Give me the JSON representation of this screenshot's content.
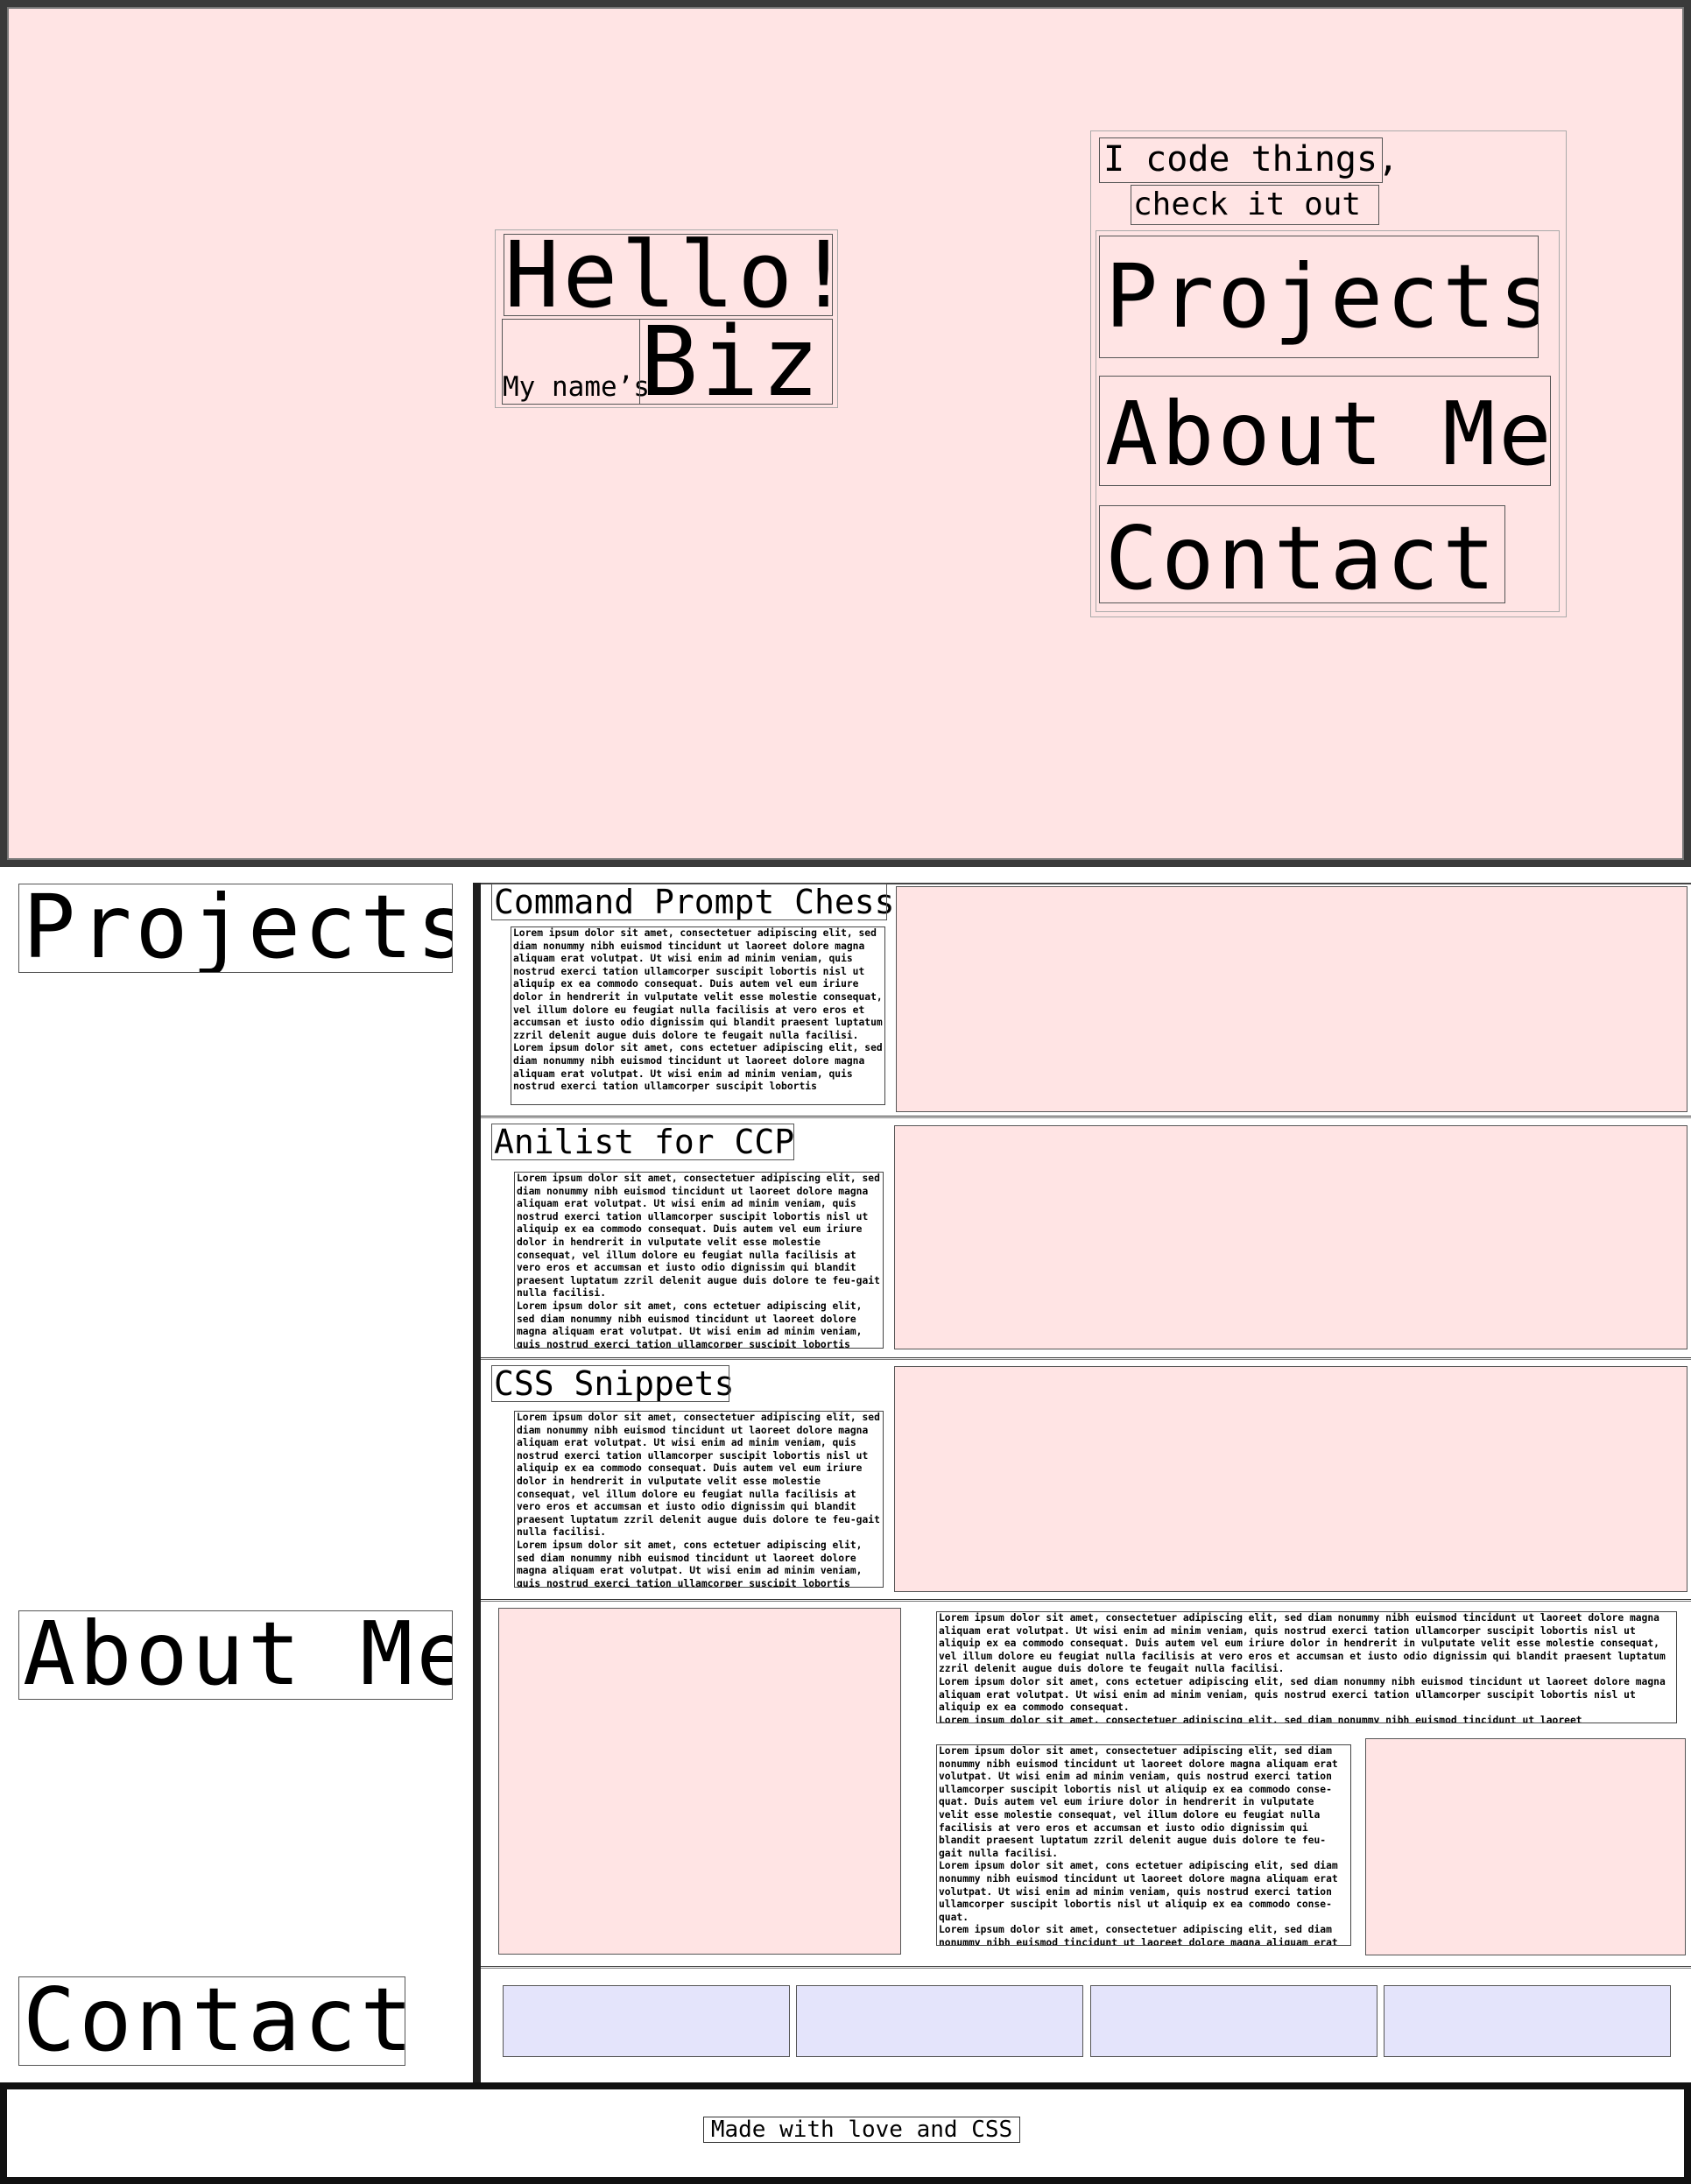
{
  "hero": {
    "hello": "Hello!",
    "my_name": "My name’s",
    "name": "Biz",
    "tagline_line1": "I code things,",
    "tagline_line2": "check it out",
    "nav": [
      "Projects",
      "About Me",
      "Contact"
    ]
  },
  "sections": {
    "projects_heading": "Projects",
    "about_heading": "About Me",
    "contact_heading": "Contact"
  },
  "projects": [
    {
      "title": "Command Prompt Chess",
      "text": "Lorem ipsum dolor sit amet, consectetuer adipiscing elit, sed diam nonummy nibh euismod tincidunt ut laoreet dolore magna aliquam erat volutpat. Ut wisi enim ad minim veniam, quis nostrud exerci tation ullamcorper suscipit lobortis nisl ut aliquip ex ea commodo consequat. Duis autem vel eum iriure dolor in hendrerit in vulputate velit esse molestie consequat, vel illum dolore eu feugiat nulla facilisis at vero eros et accumsan et iusto odio dignissim qui blandit praesent luptatum zzril delenit augue duis dolore te feugait nulla facilisi.\nLorem ipsum dolor sit amet, cons ectetuer adipiscing elit, sed diam nonummy nibh euismod tincidunt ut laoreet dolore magna aliquam erat volutpat. Ut wisi enim ad minim veniam, quis nostrud exerci tation ullamcorper suscipit lobortis"
    },
    {
      "title": "Anilist for CCP",
      "text": "Lorem ipsum dolor sit amet, consectetuer adipiscing elit, sed diam nonummy nibh euismod tincidunt ut laoreet dolore magna aliquam erat volutpat. Ut wisi enim ad minim veniam, quis nostrud exerci tation ullamcorper suscipit lobortis nisl ut aliquip ex ea commodo consequat. Duis autem vel eum iriure dolor in hendrerit in vulputate velit esse molestie consequat, vel illum dolore eu feugiat nulla facilisis at vero eros et accumsan et iusto odio dignissim qui blandit praesent luptatum zzril delenit augue duis dolore te feu-gait nulla facilisi.\nLorem ipsum dolor sit amet, cons ectetuer adipiscing elit, sed diam nonummy nibh euismod tincidunt ut laoreet dolore magna aliquam erat volutpat. Ut wisi enim ad minim veniam, quis nostrud exerci tation ullamcorper suscipit lobortis"
    },
    {
      "title": "CSS Snippets",
      "text": "Lorem ipsum dolor sit amet, consectetuer adipiscing elit, sed diam nonummy nibh euismod tincidunt ut laoreet dolore magna aliquam erat volutpat. Ut wisi enim ad minim veniam, quis nostrud exerci tation ullamcorper suscipit lobortis nisl ut aliquip ex ea commodo consequat. Duis autem vel eum iriure dolor in hendrerit in vulputate velit esse molestie consequat, vel illum dolore eu feugiat nulla facilisis at vero eros et accumsan et iusto odio dignissim qui blandit praesent luptatum zzril delenit augue duis dolore te feu-gait nulla facilisi.\nLorem ipsum dolor sit amet, cons ectetuer adipiscing elit, sed diam nonummy nibh euismod tincidunt ut laoreet dolore magna aliquam erat volutpat. Ut wisi enim ad minim veniam, quis nostrud exerci tation ullamcorper suscipit lobortis"
    }
  ],
  "about": {
    "text_top": "Lorem ipsum dolor sit amet, consectetuer adipiscing elit, sed diam nonummy nibh euismod tincidunt ut laoreet dolore magna aliquam erat volutpat. Ut wisi enim ad minim veniam, quis nostrud exerci tation ullamcorper suscipit lobortis nisl ut aliquip ex ea commodo consequat. Duis autem vel eum iriure dolor in hendrerit in vulputate velit esse molestie consequat, vel illum dolore eu feugiat nulla facilisis at vero eros et accumsan et iusto odio dignissim qui blandit praesent luptatum zzril delenit augue duis dolore te feugait nulla facilisi.\nLorem ipsum dolor sit amet, cons ectetuer adipiscing elit, sed diam nonummy nibh euismod tincidunt ut laoreet dolore magna aliquam erat volutpat. Ut wisi enim ad minim veniam, quis nostrud exerci tation ullamcorper suscipit lobortis nisl ut aliquip ex ea commodo consequat.\nLorem ipsum dolor sit amet, consectetuer adipiscing elit, sed diam nonummy nibh euismod tincidunt ut laoreet",
    "text_bottom": "Lorem ipsum dolor sit amet, consectetuer adipiscing elit, sed diam nonummy nibh euismod tincidunt ut laoreet dolore magna aliquam erat volutpat. Ut wisi enim ad minim veniam, quis nostrud exerci tation ullamcorper suscipit lobortis nisl ut aliquip ex ea commodo conse-quat. Duis autem vel eum iriure dolor in hendrerit in vulputate velit esse molestie consequat, vel illum dolore eu feugiat nulla facilisis at vero eros et accumsan et iusto odio dignissim qui blandit praesent luptatum zzril delenit augue duis dolore te feu-gait nulla facilisi.\nLorem ipsum dolor sit amet, cons ectetuer adipiscing elit, sed diam nonummy nibh euismod tincidunt ut laoreet dolore magna aliquam erat volutpat. Ut wisi enim ad minim veniam, quis nostrud exerci tation ullamcorper suscipit lobortis nisl ut aliquip ex ea commodo conse-quat.\nLorem ipsum dolor sit amet, consectetuer adipiscing elit, sed diam nonummy nibh euismod tincidunt ut laoreet dolore magna aliquam erat"
  },
  "footer": {
    "text": "Made with love and CSS"
  },
  "colors": {
    "hero_bg": "#ffe4e4",
    "placeholder_pink": "#ffe4e4",
    "placeholder_lavender": "#e4e4fb",
    "rule": "#1e1e1e"
  }
}
